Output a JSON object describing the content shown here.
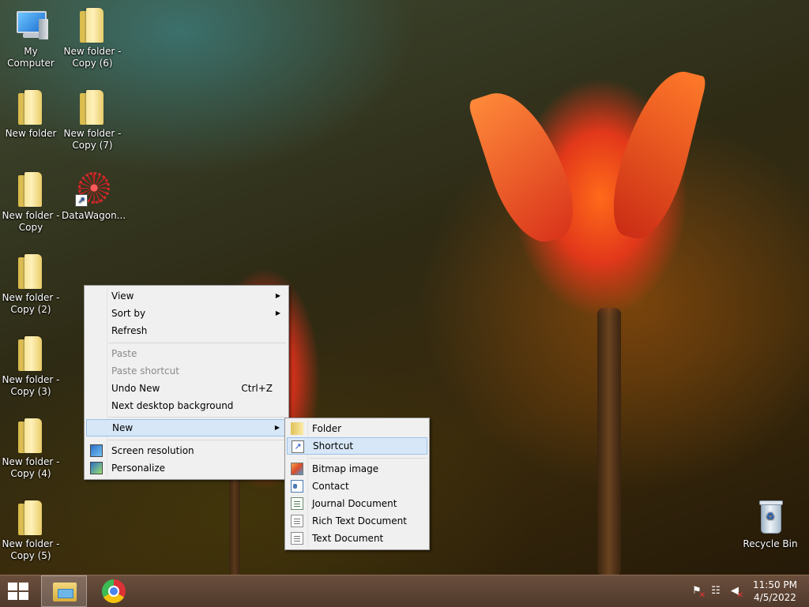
{
  "desktop": {
    "icons": [
      {
        "label": "My Computer",
        "type": "computer"
      },
      {
        "label": "New folder - Copy (6)",
        "type": "folder"
      },
      {
        "label": "New folder",
        "type": "folder"
      },
      {
        "label": "New folder - Copy (7)",
        "type": "folder"
      },
      {
        "label": "New folder - Copy",
        "type": "folder"
      },
      {
        "label": "DataWagon...",
        "type": "shortcut"
      },
      {
        "label": "New folder - Copy (2)",
        "type": "folder"
      },
      {
        "label": "New folder - Copy (3)",
        "type": "folder"
      },
      {
        "label": "New folder - Copy (4)",
        "type": "folder"
      },
      {
        "label": "New folder - Copy (5)",
        "type": "folder"
      },
      {
        "label": "Recycle Bin",
        "type": "recycle-bin"
      }
    ]
  },
  "context_menu": {
    "view": "View",
    "sort_by": "Sort by",
    "refresh": "Refresh",
    "paste": "Paste",
    "paste_shortcut": "Paste shortcut",
    "undo_new": "Undo New",
    "undo_new_shortcut": "Ctrl+Z",
    "next_background": "Next desktop background",
    "new": "New",
    "screen_resolution": "Screen resolution",
    "personalize": "Personalize"
  },
  "new_submenu": {
    "folder": "Folder",
    "shortcut": "Shortcut",
    "bitmap": "Bitmap image",
    "contact": "Contact",
    "journal": "Journal Document",
    "rtf": "Rich Text Document",
    "text": "Text Document"
  },
  "taskbar": {
    "time": "11:50 PM",
    "date": "4/5/2022"
  },
  "colors": {
    "menu_highlight": "#d7e7f7",
    "menu_highlight_border": "#9cc2ea",
    "taskbar": "#5c4434"
  }
}
